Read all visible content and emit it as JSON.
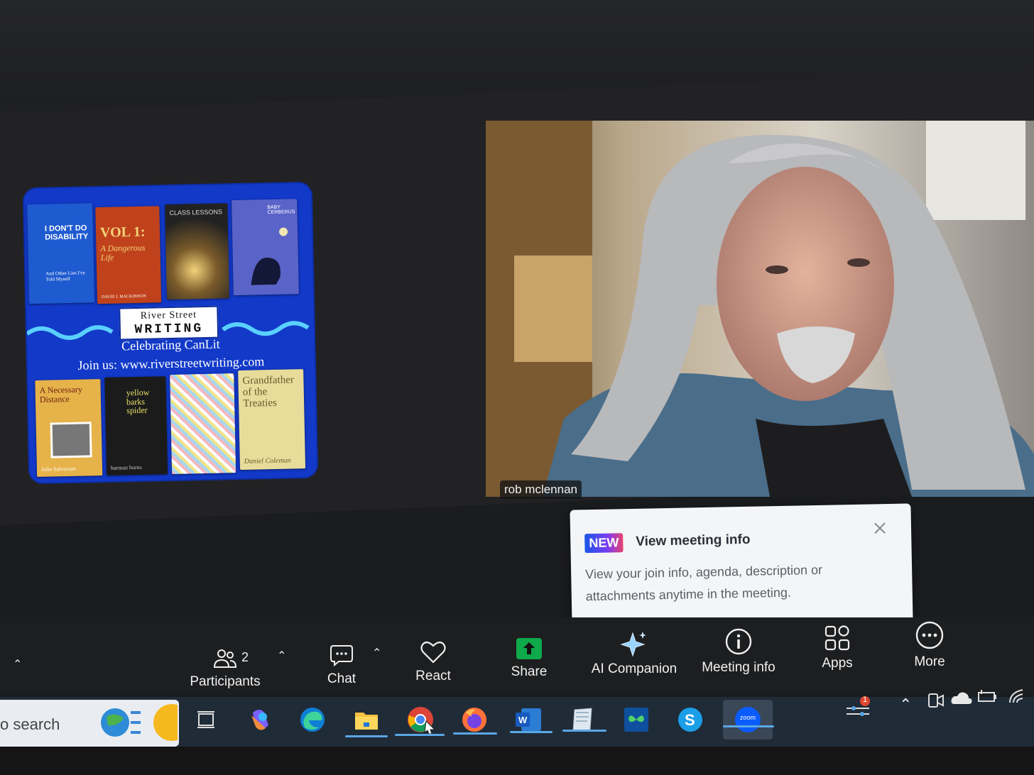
{
  "poster": {
    "books_top": [
      {
        "title": "I DON'T DO DISABILITY",
        "sub": "And Other Lies I've Told Myself",
        "color": "#1e5ad0"
      },
      {
        "title": "VOL 1:",
        "sub": "A Dangerous Life",
        "author": "DAVID J. MACKINNON",
        "color": "#c0421c"
      },
      {
        "title": "CLASS LESSONS",
        "color": "#2a2a2a"
      },
      {
        "title": "BABY CERBERUS",
        "color": "#5a63c8"
      }
    ],
    "brand_line1": "River Street",
    "brand_line2": "WRITING",
    "tagline": "Celebrating CanLit",
    "join": "Join us: www.riverstreetwriting.com",
    "books_bottom": [
      {
        "title": "A Necessary Distance",
        "author": "Julie Salverson",
        "color": "#e6b24a"
      },
      {
        "title": "yellow barks spider",
        "author": "harman burns",
        "color": "#1b1b1b"
      },
      {
        "title": "",
        "color": "#e9e7e2"
      },
      {
        "title": "Grandfather of the Treaties",
        "author": "Daniel Coleman",
        "color": "#e8dc9a"
      }
    ]
  },
  "participant": {
    "name": "rob mclennan"
  },
  "tooltip": {
    "badge": "NEW",
    "title": "View meeting info",
    "body": "View your join info, agenda, description or attachments anytime in the meeting."
  },
  "toolbar": {
    "participants_label": "Participants",
    "participants_count": "2",
    "chat_label": "Chat",
    "react_label": "React",
    "share_label": "Share",
    "ai_label": "AI Companion",
    "meeting_info_label": "Meeting info",
    "apps_label": "Apps",
    "more_label": "More"
  },
  "taskbar": {
    "search_text": "o search",
    "notification_count": "1",
    "zoom_label": "zoom"
  },
  "colors": {
    "share_green": "#0ea94b",
    "zoom_blue": "#0b5cff",
    "accent": "#1a56e8"
  }
}
